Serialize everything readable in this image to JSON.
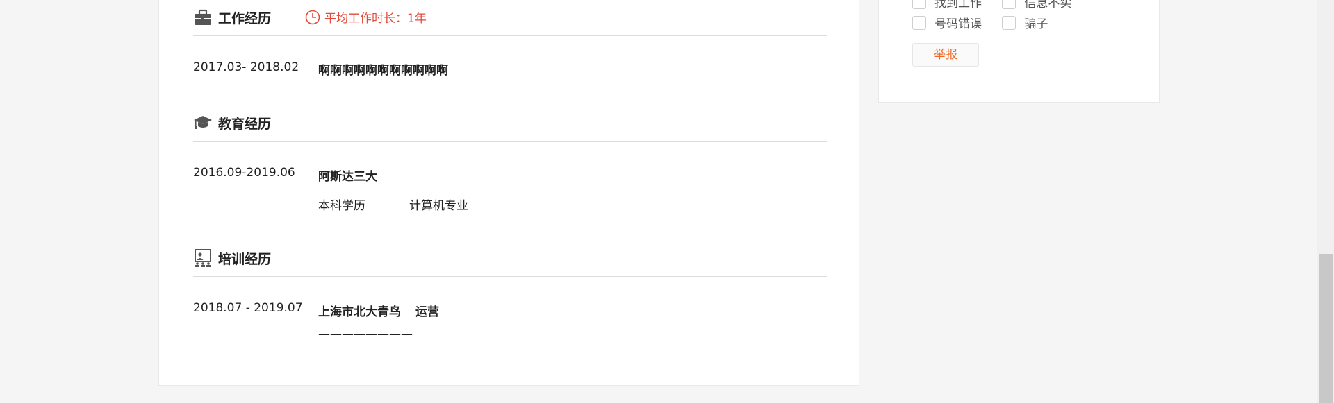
{
  "work": {
    "title": "工作经历",
    "avg_duration": "平均工作时长：1年",
    "entries": [
      {
        "date": "2017.03- 2018.02",
        "company": "啊啊啊啊啊啊啊啊啊啊啊"
      }
    ]
  },
  "education": {
    "title": "教育经历",
    "entries": [
      {
        "date": "2016.09-2019.06",
        "school": "阿斯达三大",
        "degree": "本科学历",
        "major": "计算机专业"
      }
    ]
  },
  "training": {
    "title": "培训经历",
    "entries": [
      {
        "date": "2018.07 - 2019.07",
        "org": "上海市北大青鸟",
        "course": "运营",
        "detail": "————————"
      }
    ]
  },
  "report_panel": {
    "options": [
      "找到工作",
      "信息不实",
      "号码错误",
      "骗子"
    ],
    "report_button": "举报"
  },
  "colors": {
    "accent_red": "#e24a3b",
    "report_orange": "#ef6a2a"
  }
}
